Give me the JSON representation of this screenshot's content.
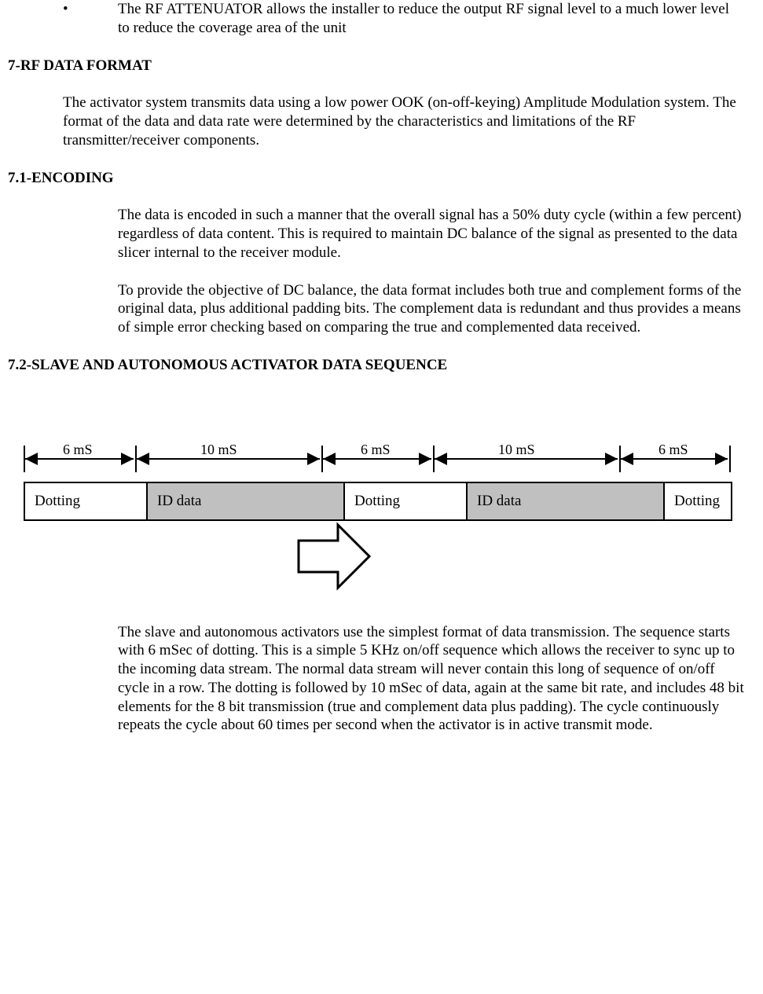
{
  "bullet": {
    "mark": "•",
    "text": "The RF ATTENUATOR allows the installer to reduce the output RF signal level to a much lower level to reduce the coverage area of the unit"
  },
  "sections": {
    "s7_title": "7-RF DATA FORMAT",
    "s7_para": "The activator system transmits data using a low power OOK (on-off-keying) Amplitude Modulation system.  The format of the data and data rate were determined by the characteristics and limitations of the RF transmitter/receiver components.",
    "s71_title": "7.1-ENCODING",
    "s71_p1": "The data is encoded in such a manner that the overall signal has a 50% duty cycle (within a few percent) regardless of data content.  This is required to maintain DC balance of the signal as presented to the data slicer internal to the receiver module.",
    "s71_p2": "To provide the objective of DC balance, the data format includes both true and complement forms of the original data, plus additional padding bits.  The complement data is redundant and thus provides a means of simple error checking based on comparing the true and complemented data received.",
    "s72_title": "7.2-SLAVE AND AUTONOMOUS ACTIVATOR DATA SEQUENCE",
    "s72_p1": "The slave and autonomous activators use the simplest format of data transmission.  The sequence starts with 6 mSec of dotting.  This is a simple 5 KHz on/off sequence which allows the receiver to sync up to the incoming data stream.  The normal data stream will never contain this long of sequence of on/off cycle in a row.  The dotting is followed by 10 mSec of data, again at the same bit rate, and includes 48 bit elements for the 8 bit transmission (true and complement data plus padding).  The cycle continuously repeats the cycle about 60 times per second when the activator is in active transmit mode."
  },
  "chart_data": {
    "type": "table",
    "title": "Slave/Autonomous Activator Data Sequence timing",
    "segments": [
      {
        "label": "Dotting",
        "duration_ms": 6,
        "fill": "white"
      },
      {
        "label": "ID data",
        "duration_ms": 10,
        "fill": "gray"
      },
      {
        "label": "Dotting",
        "duration_ms": 6,
        "fill": "white"
      },
      {
        "label": "ID data",
        "duration_ms": 10,
        "fill": "gray"
      },
      {
        "label": "Dotting",
        "duration_ms": 6,
        "fill": "white"
      }
    ],
    "timing_labels": [
      "6 mS",
      "10 mS",
      "6 mS",
      "10 mS",
      "6 mS"
    ],
    "unit": "mS"
  }
}
